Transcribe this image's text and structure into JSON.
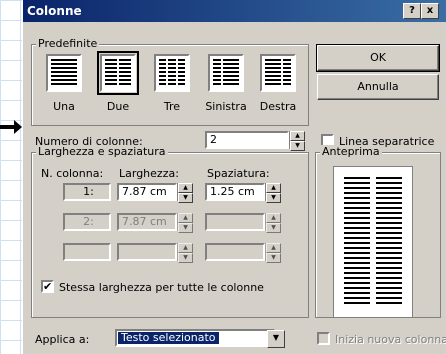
{
  "window": {
    "title": "Colonne",
    "help_btn": "?",
    "close_btn": "x"
  },
  "predefinite": {
    "label": "Predefinite",
    "items": [
      "Una",
      "Due",
      "Tre",
      "Sinistra",
      "Destra"
    ],
    "selected": "Due"
  },
  "buttons": {
    "ok": "OK",
    "annulla": "Annulla"
  },
  "numero_colonne": {
    "label": "Numero di colonne:",
    "value": "2"
  },
  "linea_separatrice": {
    "label": "Linea separatrice",
    "checked": false
  },
  "larghezza": {
    "label": "Larghezza e spaziatura",
    "headers": {
      "n_colonna": "N. colonna:",
      "larghezza": "Larghezza:",
      "spaziatura": "Spaziatura:"
    },
    "rows": [
      {
        "n": "1:",
        "larghezza": "7.87 cm",
        "spaziatura": "1.25 cm",
        "enabled": true
      },
      {
        "n": "2:",
        "larghezza": "7.87 cm",
        "spaziatura": "",
        "enabled": false
      },
      {
        "n": "",
        "larghezza": "",
        "spaziatura": "",
        "enabled": false
      }
    ],
    "stessa_larghezza": {
      "label": "Stessa larghezza per tutte le colonne",
      "checked": true
    }
  },
  "anteprima": {
    "label": "Anteprima"
  },
  "applica": {
    "label": "Applica a:",
    "value": "Testo selezionato"
  },
  "inizia_nuova": {
    "label": "Inizia nuova colonna",
    "checked": false,
    "enabled": false
  }
}
